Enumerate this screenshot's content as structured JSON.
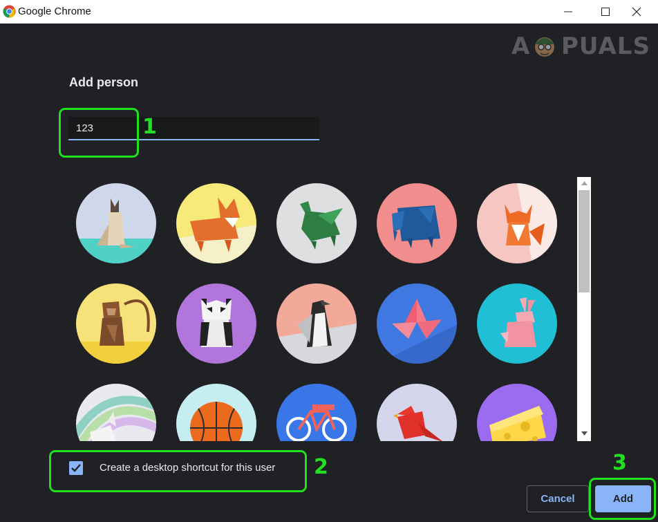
{
  "window": {
    "title": "Google Chrome",
    "controls": [
      "minimize-icon",
      "maximize-icon",
      "close-icon"
    ]
  },
  "watermark": {
    "left_text": "A",
    "right_text": "PUALS"
  },
  "dialog": {
    "heading": "Add person",
    "name_input": {
      "value": "123",
      "placeholder": ""
    },
    "avatars": [
      {
        "name": "origami-cat",
        "bg": "#cfd7ea"
      },
      {
        "name": "origami-corgi",
        "bg": "#f7ea7a"
      },
      {
        "name": "origami-dragon",
        "bg": "#dedfe1"
      },
      {
        "name": "origami-elephant",
        "bg": "#f28d8d"
      },
      {
        "name": "origami-fox",
        "bg": "#f6c7c2"
      },
      {
        "name": "origami-monkey",
        "bg": "#f7e27a"
      },
      {
        "name": "origami-panda",
        "bg": "#b175dc"
      },
      {
        "name": "origami-penguin",
        "bg": "#f3a99a"
      },
      {
        "name": "origami-butterfly",
        "bg": "#3f78e0"
      },
      {
        "name": "origami-rabbit",
        "bg": "#20bfd6"
      },
      {
        "name": "origami-unicorn",
        "bg": "#c7e6c9"
      },
      {
        "name": "basketball",
        "bg": "#c6eef1"
      },
      {
        "name": "bicycle",
        "bg": "#3977e8"
      },
      {
        "name": "origami-bird",
        "bg": "#d4d4ea"
      },
      {
        "name": "cheese",
        "bg": "#9b6bf0"
      }
    ],
    "checkbox": {
      "label": "Create a desktop shortcut for this user",
      "checked": true
    },
    "buttons": {
      "cancel": "Cancel",
      "add": "Add"
    }
  },
  "annotations": {
    "step1": "1",
    "step2": "2",
    "step3": "3",
    "color": "#20e020"
  },
  "colors": {
    "background": "#202124",
    "accent": "#8ab4f8",
    "text": "#e8eaed"
  }
}
